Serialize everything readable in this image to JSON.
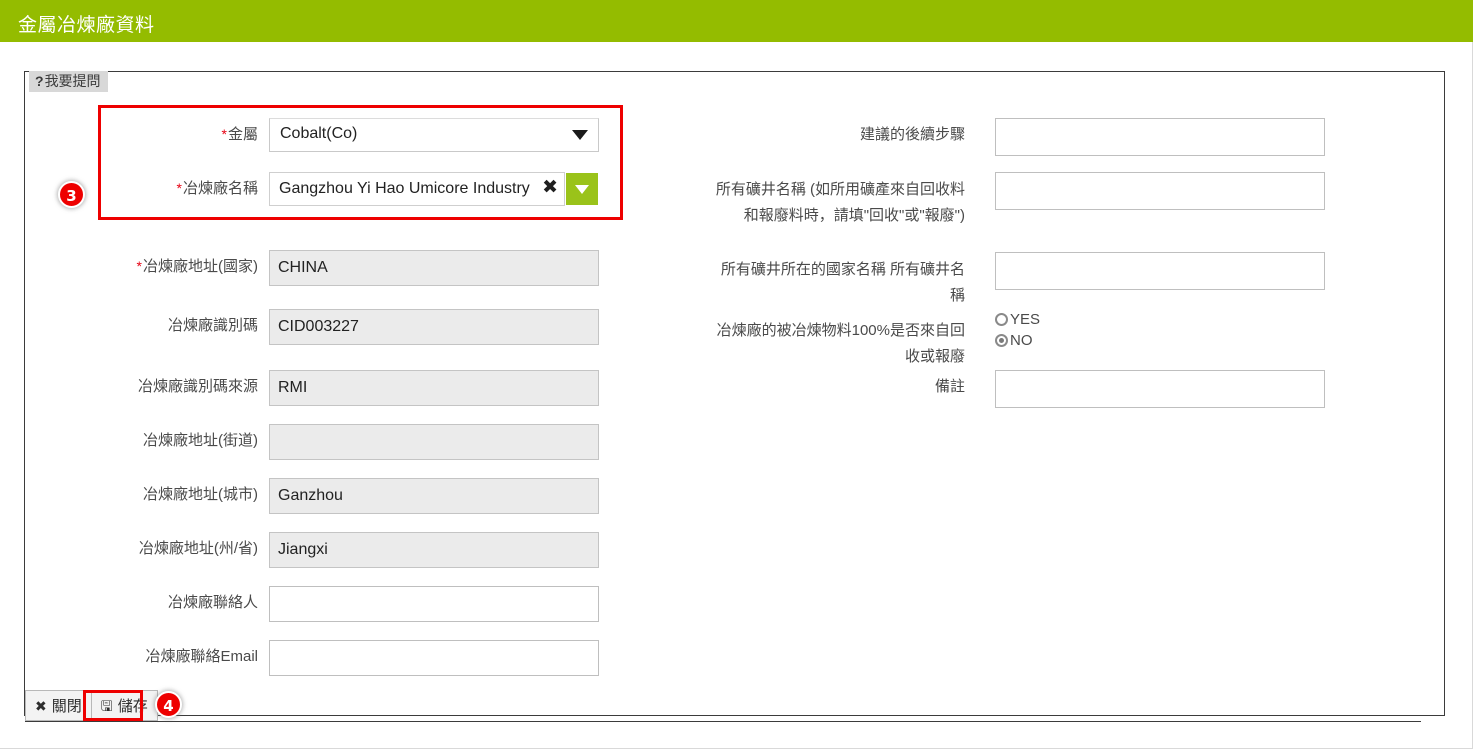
{
  "header": {
    "title": "金屬冶煉廠資料",
    "bar_color": "#94bc00"
  },
  "ask_tab": {
    "icon": "question-mark-icon",
    "icon_glyph": "?",
    "label": "我要提問"
  },
  "badges": {
    "step3": "3",
    "step4": "4",
    "color": "#ee0000"
  },
  "left_column": {
    "metal": {
      "label": "金屬",
      "required": true,
      "required_mark": "*",
      "value": "Cobalt(Co)",
      "caret_icon": "chevron-down-icon"
    },
    "smelter_name": {
      "label": "冶煉廠名稱",
      "required": true,
      "required_mark": "*",
      "value": "Gangzhou Yi Hao Umicore Industry Co.",
      "clear_icon": "close-x-icon",
      "clear_glyph": "✖",
      "lookup_icon": "chevron-down-icon",
      "lookup_color": "#9ac31a"
    },
    "fields": [
      {
        "label": "冶煉廠地址(國家)",
        "required": true,
        "required_mark": "*",
        "value": "CHINA",
        "readonly": true
      },
      {
        "label": "冶煉廠識別碼",
        "required": false,
        "required_mark": "",
        "value": "CID003227",
        "readonly": true
      },
      {
        "label": "冶煉廠識別碼來源",
        "required": false,
        "required_mark": "",
        "value": "RMI",
        "readonly": true
      },
      {
        "label": "冶煉廠地址(街道)",
        "required": false,
        "required_mark": "",
        "value": "",
        "readonly": true
      },
      {
        "label": "冶煉廠地址(城市)",
        "required": false,
        "required_mark": "",
        "value": "Ganzhou",
        "readonly": true
      },
      {
        "label": "冶煉廠地址(州/省)",
        "required": false,
        "required_mark": "",
        "value": "Jiangxi",
        "readonly": true
      },
      {
        "label": "冶煉廠聯絡人",
        "required": false,
        "required_mark": "",
        "value": "",
        "readonly": false
      },
      {
        "label": "冶煉廠聯絡Email",
        "required": false,
        "required_mark": "",
        "value": "",
        "readonly": false
      }
    ]
  },
  "right_column": {
    "next_steps": {
      "label": "建議的後續步驟",
      "value": ""
    },
    "all_mine_names": {
      "label": "所有礦井名稱 (如所用礦產來自回收料和報廢料時，請填\"回收\"或\"報廢\")",
      "value": ""
    },
    "mine_countries": {
      "label": "所有礦井所在的國家名稱 所有礦井名稱",
      "value": ""
    },
    "recycled_question": {
      "label": "冶煉廠的被冶煉物料100%是否來自回收或報廢",
      "options": [
        {
          "label": "YES",
          "selected": false
        },
        {
          "label": "NO",
          "selected": true
        }
      ]
    },
    "remarks": {
      "label": "備註",
      "value": ""
    }
  },
  "toolbar": {
    "close": {
      "label": "關閉",
      "icon": "close-x-icon",
      "icon_glyph": "✖"
    },
    "save": {
      "label": "儲存",
      "icon": "floppy-disk-icon",
      "icon_glyph": "🖫"
    }
  }
}
